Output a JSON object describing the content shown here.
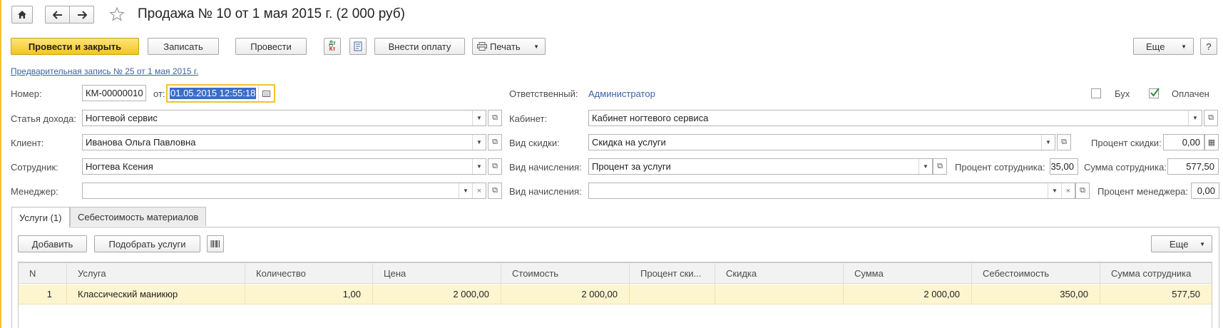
{
  "window": {
    "title": "Продажа № 10 от 1 мая 2015 г. (2 000 руб)",
    "home_icon": "home-icon",
    "back_icon": "arrow-left-icon",
    "forward_icon": "arrow-right-icon",
    "star_icon": "star-icon"
  },
  "toolbar": {
    "post_close": "Провести и закрыть",
    "save": "Записать",
    "post": "Провести",
    "dt_kt_top": "Дт",
    "dt_kt_bottom": "Кт",
    "pay": "Внести оплату",
    "print": "Печать",
    "more": "Еще",
    "help": "?"
  },
  "prelink": "Предварительная запись № 25 от 1 мая 2015 г.",
  "header": {
    "number_label": "Номер:",
    "number_value": "КМ-00000010",
    "from_label": "от:",
    "date_value": "01.05.2015 12:55:18",
    "responsible_label": "Ответственный:",
    "responsible_value": "Администратор",
    "buh_label": "Бух",
    "buh_checked": false,
    "paid_label": "Оплачен",
    "paid_checked": true
  },
  "fields": {
    "income_label": "Статья дохода:",
    "income_value": "Ногтевой сервис",
    "cabinet_label": "Кабинет:",
    "cabinet_value": "Кабинет ногтевого сервиса",
    "client_label": "Клиент:",
    "client_value": "Иванова Ольга Павловна",
    "discount_type_label": "Вид скидки:",
    "discount_type_value": "Скидка на услуги",
    "discount_pct_label": "Процент скидки:",
    "discount_pct_value": "0,00",
    "employee_label": "Сотрудник:",
    "employee_value": "Ногтева Ксения",
    "accrual_label": "Вид начисления:",
    "accrual_value": "Процент за услуги",
    "employee_pct_label": "Процент сотрудника:",
    "employee_pct_value": "35,00",
    "employee_sum_label": "Сумма сотрудника:",
    "employee_sum_value": "577,50",
    "manager_label": "Менеджер:",
    "manager_value": "",
    "accrual2_label": "Вид начисления:",
    "accrual2_value": "",
    "manager_pct_label": "Процент менеджера:",
    "manager_pct_value": "0,00"
  },
  "tabs": [
    {
      "label": "Услуги (1)",
      "active": true
    },
    {
      "label": "Себестоимость материалов",
      "active": false
    }
  ],
  "table_toolbar": {
    "add": "Добавить",
    "pick": "Подобрать услуги",
    "more": "Еще"
  },
  "table": {
    "columns": [
      "N",
      "Услуга",
      "Количество",
      "Цена",
      "Стоимость",
      "Процент ски...",
      "Скидка",
      "Сумма",
      "Себестоимость",
      "Сумма сотрудника"
    ],
    "rows": [
      [
        "1",
        "Классический маникюр",
        "1,00",
        "2 000,00",
        "2 000,00",
        "",
        "",
        "2 000,00",
        "350,00",
        "577,50"
      ]
    ]
  },
  "colors": {
    "accent": "#f4c522",
    "link": "#3b63a8",
    "selected_row": "#fdf5cf"
  }
}
